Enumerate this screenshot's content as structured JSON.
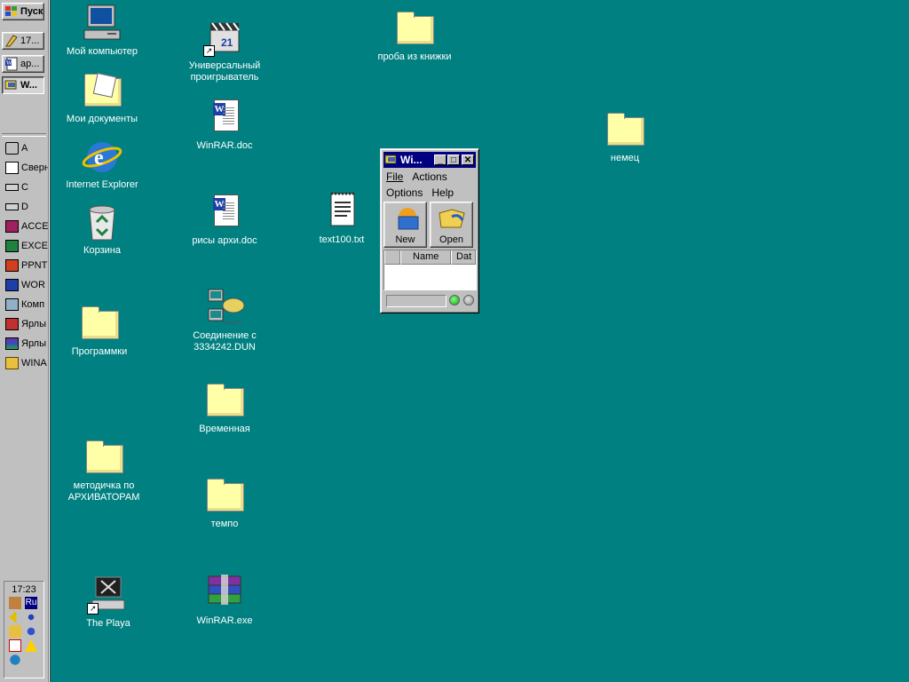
{
  "taskbar": {
    "start_label": "Пуск",
    "buttons": [
      {
        "label": "17..."
      },
      {
        "label": "ар..."
      },
      {
        "label": "W..."
      }
    ],
    "quick_launch": [
      {
        "label": "A",
        "icon": "floppy-drive-icon"
      },
      {
        "label": "Сверн",
        "icon": "minimize-all-icon"
      },
      {
        "label": "C",
        "icon": "hard-drive-icon"
      },
      {
        "label": "D",
        "icon": "hard-drive-icon"
      },
      {
        "label": "ACCE",
        "icon": "access-icon"
      },
      {
        "label": "EXCE",
        "icon": "excel-icon"
      },
      {
        "label": "PPNT",
        "icon": "powerpoint-icon"
      },
      {
        "label": "WOR",
        "icon": "word-icon"
      },
      {
        "label": "Комп",
        "icon": "computer-icon"
      },
      {
        "label": "Ярлы",
        "icon": "shortcut-icon"
      },
      {
        "label": "Ярлы",
        "icon": "shortcut-icon"
      },
      {
        "label": "WINA",
        "icon": "winamp-icon"
      }
    ],
    "clock": "17:23",
    "language": "Ru"
  },
  "desktop": {
    "icons": [
      {
        "label": "Мой компьютер",
        "icon": "my-computer-icon"
      },
      {
        "label": "Мои документы",
        "icon": "my-documents-icon"
      },
      {
        "label": "Internet Explorer",
        "icon": "internet-explorer-icon"
      },
      {
        "label": "Корзина",
        "icon": "recycle-bin-icon"
      },
      {
        "label": "Программки",
        "icon": "folder-icon"
      },
      {
        "label": "методичка по АРХИВАТОРАМ",
        "icon": "folder-icon"
      },
      {
        "label": "The Playa",
        "icon": "the-playa-icon"
      },
      {
        "label": "Универсальный проигрыватель",
        "icon": "media-player-icon"
      },
      {
        "label": "WinRAR.doc",
        "icon": "word-document-icon"
      },
      {
        "label": "рисы архи.doc",
        "icon": "word-document-icon"
      },
      {
        "label": "Соединение с 3334242.DUN",
        "icon": "dialup-connection-icon"
      },
      {
        "label": "Временная",
        "icon": "folder-icon"
      },
      {
        "label": "темпо",
        "icon": "folder-icon"
      },
      {
        "label": "WinRAR.exe",
        "icon": "winrar-archive-icon"
      },
      {
        "label": "text100.txt",
        "icon": "text-file-icon"
      },
      {
        "label": "проба из книжки",
        "icon": "folder-icon"
      },
      {
        "label": "немец",
        "icon": "folder-icon"
      }
    ]
  },
  "winrar": {
    "title": "Wi...",
    "menu_row1": [
      "File",
      "Actions"
    ],
    "menu_row2": [
      "Options",
      "Help"
    ],
    "tools": [
      {
        "label": "New"
      },
      {
        "label": "Open"
      }
    ],
    "columns": [
      "Name",
      "Dat"
    ]
  },
  "colors": {
    "desktop": "#008080",
    "title_bar": "#000080",
    "face": "#c0c0c0"
  }
}
